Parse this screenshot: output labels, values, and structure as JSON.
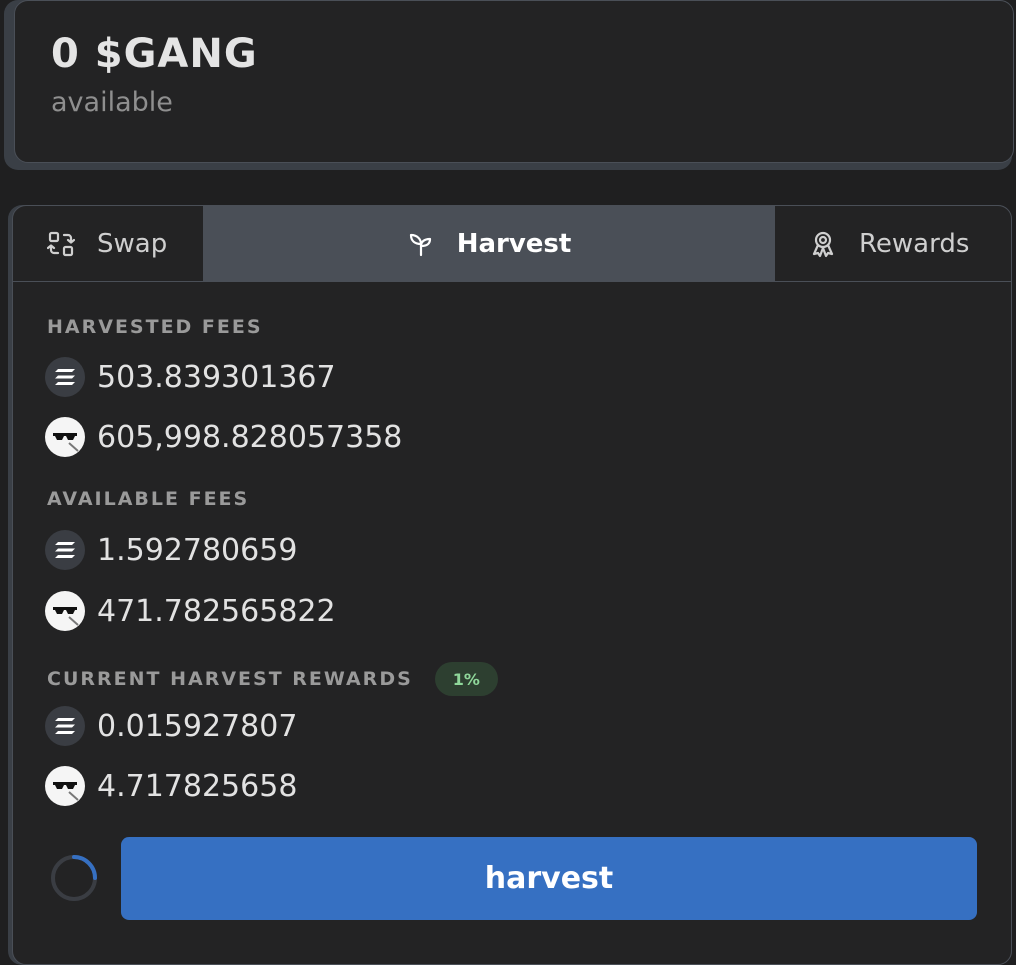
{
  "balance": {
    "amount": "0 $GANG",
    "label": "available"
  },
  "tabs": [
    {
      "label": "Swap",
      "icon": "swap-icon",
      "active": false
    },
    {
      "label": "Harvest",
      "icon": "sprout-icon",
      "active": true
    },
    {
      "label": "Rewards",
      "icon": "award-icon",
      "active": false
    }
  ],
  "harvested_fees": {
    "label": "HARVESTED FEES",
    "sol": "503.839301367",
    "gang": "605,998.828057358"
  },
  "available_fees": {
    "label": "AVAILABLE FEES",
    "sol": "1.592780659",
    "gang": "471.782565822"
  },
  "current_rewards": {
    "label": "CURRENT HARVEST REWARDS",
    "badge": "1%",
    "sol": "0.015927807",
    "gang": "4.717825658"
  },
  "actions": {
    "harvest_label": "harvest"
  },
  "colors": {
    "background": "#1f1f20",
    "card": "#232324",
    "active_tab": "#4a4f57",
    "button": "#3670c2",
    "badge_bg": "#2d3f30",
    "badge_text": "#8fd79a"
  }
}
